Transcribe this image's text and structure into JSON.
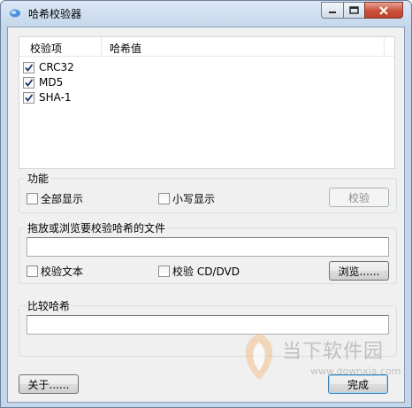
{
  "window": {
    "title": "哈希校验器"
  },
  "list": {
    "columns": [
      "校验项",
      "哈希值"
    ],
    "items": [
      {
        "label": "CRC32",
        "checked": true
      },
      {
        "label": "MD5",
        "checked": true
      },
      {
        "label": "SHA-1",
        "checked": true
      }
    ]
  },
  "function_group": {
    "legend": "功能",
    "show_all": "全部显示",
    "lowercase": "小写显示",
    "verify_button": "校验"
  },
  "file_group": {
    "legend": "拖放或浏览要校验哈希的文件",
    "path_value": "",
    "verify_text": "校验文本",
    "verify_cd": "校验 CD/DVD",
    "browse_button": "浏览......"
  },
  "compare_group": {
    "legend": "比较哈希",
    "hash_value": ""
  },
  "footer": {
    "about_button": "关于......",
    "finish_button": "完成"
  },
  "watermark": {
    "brand": "当下软件园",
    "url": "www.downxia.com"
  },
  "colors": {
    "titlebar": "#c6d8ec",
    "close_button": "#c9503b",
    "client_bg": "#f0f0f0",
    "check_mark": "#1a3a6e"
  }
}
